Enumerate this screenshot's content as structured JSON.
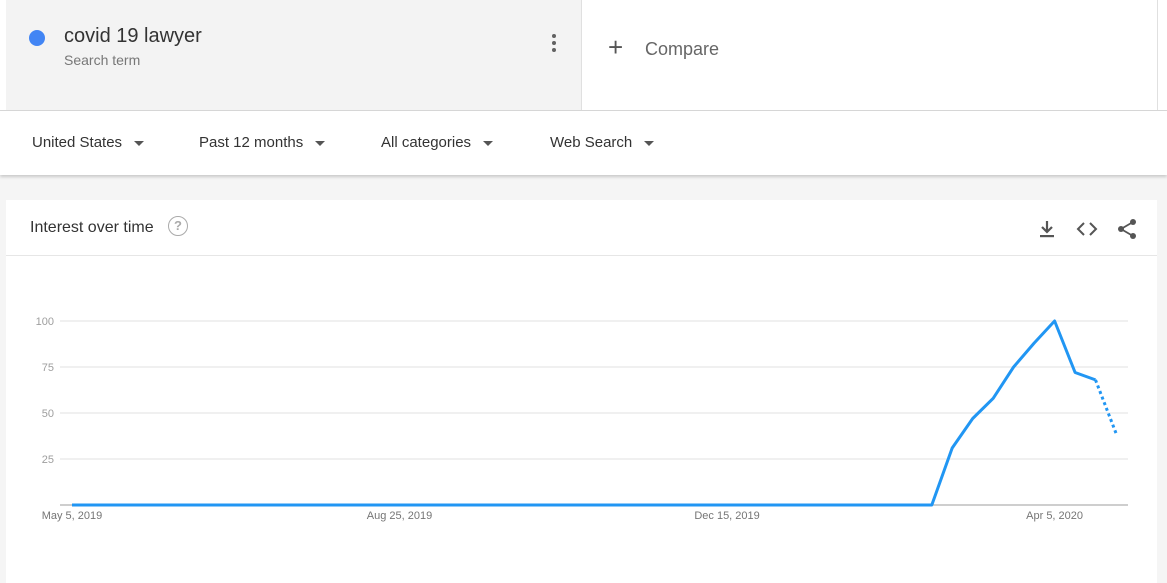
{
  "search_term": {
    "name": "covid 19 lawyer",
    "label": "Search term",
    "color": "#4285f4"
  },
  "compare": {
    "label": "Compare"
  },
  "filters": {
    "region": "United States",
    "time": "Past 12 months",
    "category": "All categories",
    "property": "Web Search"
  },
  "card": {
    "title": "Interest over time",
    "help_icon": "question-icon",
    "tools": [
      "download-icon",
      "embed-icon",
      "share-icon"
    ]
  },
  "chart_data": {
    "type": "line",
    "title": "Interest over time",
    "y_ticks": [
      "100",
      "75",
      "50",
      "25"
    ],
    "x_ticks": [
      {
        "label": "May 5, 2019",
        "week": 0
      },
      {
        "label": "Aug 25, 2019",
        "week": 16
      },
      {
        "label": "Dec 15, 2019",
        "week": 32
      },
      {
        "label": "Apr 5, 2020",
        "week": 48
      }
    ],
    "ylim": [
      0,
      100
    ],
    "line_color": "#2196f3",
    "grid": true,
    "series": [
      {
        "x_start": "May 5, 2019",
        "x_step": "1 week",
        "values": [
          0,
          0,
          0,
          0,
          0,
          0,
          0,
          0,
          0,
          0,
          0,
          0,
          0,
          0,
          0,
          0,
          0,
          0,
          0,
          0,
          0,
          0,
          0,
          0,
          0,
          0,
          0,
          0,
          0,
          0,
          0,
          0,
          0,
          0,
          0,
          0,
          0,
          0,
          0,
          0,
          0,
          0,
          0,
          31,
          47,
          58,
          75,
          88,
          100,
          72,
          68,
          39
        ],
        "partial_from_index": 50
      }
    ]
  }
}
